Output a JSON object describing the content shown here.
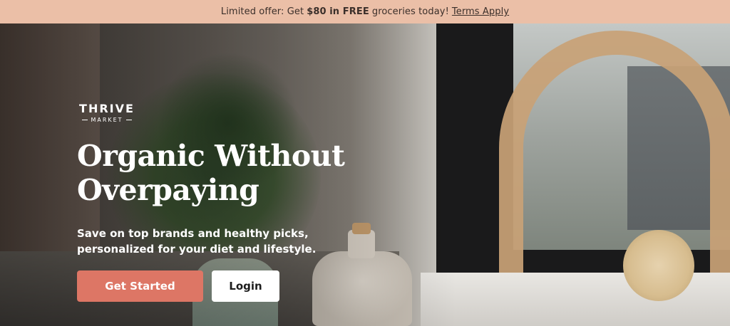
{
  "promo": {
    "prefix": "Limited offer: Get",
    "bold": "$80 in FREE",
    "suffix": "groceries today!",
    "link": "Terms Apply"
  },
  "brand": {
    "top": "THRIVE",
    "bottom": "MARKET"
  },
  "hero": {
    "headline_line1": "Organic Without",
    "headline_line2": "Overpaying",
    "subhead_line1": "Save on top brands and healthy picks,",
    "subhead_line2": "personalized for your diet and lifestyle.",
    "primary_button": "Get Started",
    "secondary_button": "Login"
  },
  "colors": {
    "promo_bg": "#ebbfa7",
    "primary_button_bg": "#dd7665",
    "secondary_button_bg": "#ffffff",
    "text_light": "#ffffff"
  }
}
